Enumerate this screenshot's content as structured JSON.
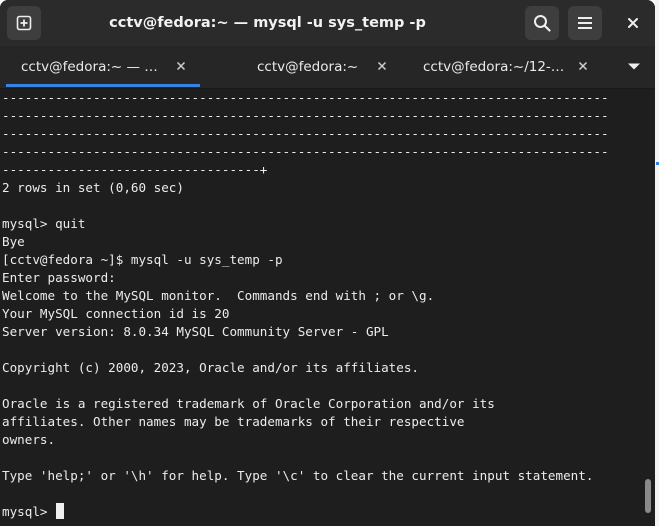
{
  "window": {
    "title": "cctv@fedora:~ — mysql -u sys_temp -p"
  },
  "headerbar": {
    "new_tab_icon": "new-tab-icon",
    "search_icon": "search-icon",
    "menu_icon": "hamburger-menu-icon",
    "close_icon": "close-icon"
  },
  "tabs": [
    {
      "label": "cctv@fedora:~ — …",
      "active": true
    },
    {
      "label": "cctv@fedora:~",
      "active": false
    },
    {
      "label": "cctv@fedora:~/12-…",
      "active": false
    }
  ],
  "terminal": {
    "lines": [
      "--------------------------------------------------------------------------------",
      "--------------------------------------------------------------------------------",
      "--------------------------------------------------------------------------------",
      "--------------------------------------------------------------------------------",
      "----------------------------------+",
      "2 rows in set (0,60 sec)",
      "",
      "mysql> quit",
      "Bye",
      "[cctv@fedora ~]$ mysql -u sys_temp -p",
      "Enter password:",
      "Welcome to the MySQL monitor.  Commands end with ; or \\g.",
      "Your MySQL connection id is 20",
      "Server version: 8.0.34 MySQL Community Server - GPL",
      "",
      "Copyright (c) 2000, 2023, Oracle and/or its affiliates.",
      "",
      "Oracle is a registered trademark of Oracle Corporation and/or its",
      "affiliates. Other names may be trademarks of their respective",
      "owners.",
      "",
      "Type 'help;' or '\\h' for help. Type '\\c' to clear the current input statement.",
      ""
    ],
    "prompt": "mysql> "
  },
  "colors": {
    "headerbar": "#2b2b2b",
    "terminal_bg": "#1e1e1e",
    "text": "#ececec",
    "accent": "#3584e4"
  }
}
